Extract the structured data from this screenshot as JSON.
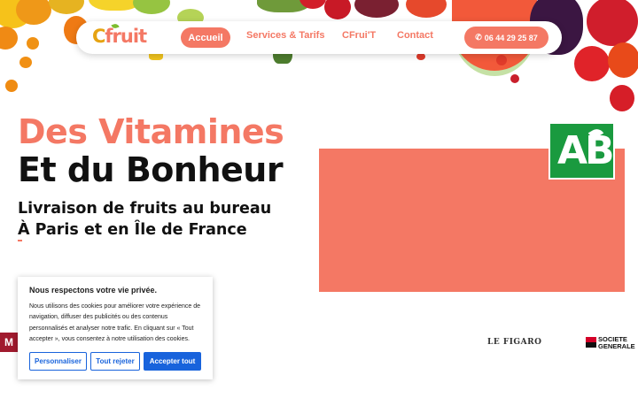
{
  "nav": {
    "logo_c": "C",
    "logo_rest": "fruit",
    "links": [
      "Accueil",
      "Services & Tarifs",
      "CFrui'T",
      "Contact"
    ],
    "phone": "06 44 29 25 87",
    "phone_icon": "phone-icon"
  },
  "hero": {
    "title_line1": "Des Vitamines",
    "title_line2": "Et du Bonheur",
    "subtitle_line1": "Livraison de fruits au bureau",
    "subtitle_line2": "À Paris et en Île de France"
  },
  "badge": {
    "label": "AB"
  },
  "partners": {
    "m": "M",
    "figaro": "LE FIGARO",
    "sg_line1": "SOCIETE",
    "sg_line2": "GENERALE"
  },
  "cookie": {
    "title": "Nous respectons votre vie privée.",
    "text": "Nous utilisons des cookies pour améliorer votre expérience de navigation, diffuser des publicités ou des contenus personnalisés et analyser notre trafic. En cliquant sur « Tout accepter », vous consentez à notre utilisation des cookies.",
    "customize": "Personnaliser",
    "reject": "Tout rejeter",
    "accept": "Accepter tout"
  },
  "colors": {
    "brand_salmon": "#f47864",
    "brand_orange": "#e6a312",
    "ab_green": "#1a9a3f",
    "cookie_blue": "#1863dc"
  }
}
